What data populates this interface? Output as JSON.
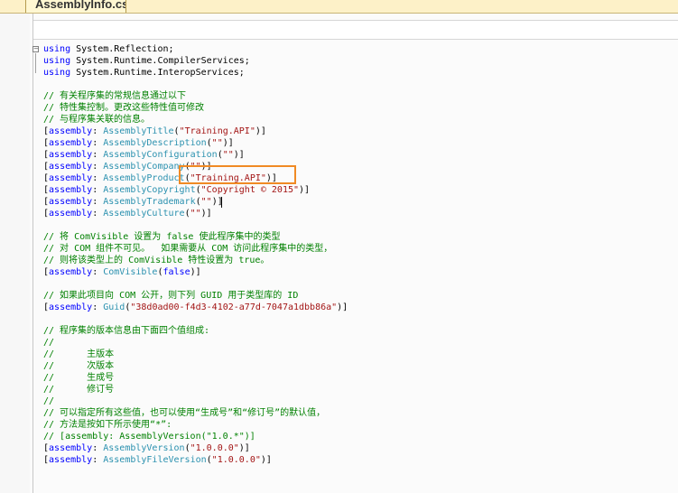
{
  "tab": {
    "title": "AssemblyInfo.cs"
  },
  "lines": [
    [
      {
        "c": "keyword",
        "t": "using"
      },
      {
        "c": "",
        "t": " System.Reflection;"
      }
    ],
    [
      {
        "c": "keyword",
        "t": "using"
      },
      {
        "c": "",
        "t": " System.Runtime.CompilerServices;"
      }
    ],
    [
      {
        "c": "keyword",
        "t": "using"
      },
      {
        "c": "",
        "t": " System.Runtime.InteropServices;"
      }
    ],
    [],
    [
      {
        "c": "comment",
        "t": "// 有关程序集的常规信息通过以下"
      }
    ],
    [
      {
        "c": "comment",
        "t": "// 特性集控制。更改这些特性值可修改"
      }
    ],
    [
      {
        "c": "comment",
        "t": "// 与程序集关联的信息。"
      }
    ],
    [
      {
        "c": "",
        "t": "["
      },
      {
        "c": "keyword",
        "t": "assembly"
      },
      {
        "c": "",
        "t": ": "
      },
      {
        "c": "type",
        "t": "AssemblyTitle"
      },
      {
        "c": "",
        "t": "("
      },
      {
        "c": "string",
        "t": "\"Training.API\""
      },
      {
        "c": "",
        "t": ")]"
      }
    ],
    [
      {
        "c": "",
        "t": "["
      },
      {
        "c": "keyword",
        "t": "assembly"
      },
      {
        "c": "",
        "t": ": "
      },
      {
        "c": "type",
        "t": "AssemblyDescription"
      },
      {
        "c": "",
        "t": "("
      },
      {
        "c": "string",
        "t": "\"\""
      },
      {
        "c": "",
        "t": ")]"
      }
    ],
    [
      {
        "c": "",
        "t": "["
      },
      {
        "c": "keyword",
        "t": "assembly"
      },
      {
        "c": "",
        "t": ": "
      },
      {
        "c": "type",
        "t": "AssemblyConfiguration"
      },
      {
        "c": "",
        "t": "("
      },
      {
        "c": "string",
        "t": "\"\""
      },
      {
        "c": "",
        "t": ")]"
      }
    ],
    [
      {
        "c": "",
        "t": "["
      },
      {
        "c": "keyword",
        "t": "assembly"
      },
      {
        "c": "",
        "t": ": "
      },
      {
        "c": "type",
        "t": "AssemblyCompany"
      },
      {
        "c": "",
        "t": "("
      },
      {
        "c": "string",
        "t": "\"\""
      },
      {
        "c": "",
        "t": ")]"
      }
    ],
    [
      {
        "c": "",
        "t": "["
      },
      {
        "c": "keyword",
        "t": "assembly"
      },
      {
        "c": "",
        "t": ": "
      },
      {
        "c": "type",
        "t": "AssemblyProduct"
      },
      {
        "c": "",
        "t": "("
      },
      {
        "c": "string",
        "t": "\"Training.API\""
      },
      {
        "c": "",
        "t": ")]"
      }
    ],
    [
      {
        "c": "",
        "t": "["
      },
      {
        "c": "keyword",
        "t": "assembly"
      },
      {
        "c": "",
        "t": ": "
      },
      {
        "c": "type",
        "t": "AssemblyCopyright"
      },
      {
        "c": "",
        "t": "("
      },
      {
        "c": "string",
        "t": "\"Copyright © 2015\""
      },
      {
        "c": "",
        "t": ")]"
      }
    ],
    [
      {
        "c": "",
        "t": "["
      },
      {
        "c": "keyword",
        "t": "assembly"
      },
      {
        "c": "",
        "t": ": "
      },
      {
        "c": "type",
        "t": "AssemblyTrademark"
      },
      {
        "c": "",
        "t": "("
      },
      {
        "c": "string",
        "t": "\"\""
      },
      {
        "c": "",
        "t": ")]"
      }
    ],
    [
      {
        "c": "",
        "t": "["
      },
      {
        "c": "keyword",
        "t": "assembly"
      },
      {
        "c": "",
        "t": ": "
      },
      {
        "c": "type",
        "t": "AssemblyCulture"
      },
      {
        "c": "",
        "t": "("
      },
      {
        "c": "string",
        "t": "\"\""
      },
      {
        "c": "",
        "t": ")]"
      }
    ],
    [],
    [
      {
        "c": "comment",
        "t": "// 将 ComVisible 设置为 false 使此程序集中的类型"
      }
    ],
    [
      {
        "c": "comment",
        "t": "// 对 COM 组件不可见。  如果需要从 COM 访问此程序集中的类型，"
      }
    ],
    [
      {
        "c": "comment",
        "t": "// 则将该类型上的 ComVisible 特性设置为 true。"
      }
    ],
    [
      {
        "c": "",
        "t": "["
      },
      {
        "c": "keyword",
        "t": "assembly"
      },
      {
        "c": "",
        "t": ": "
      },
      {
        "c": "type",
        "t": "ComVisible"
      },
      {
        "c": "",
        "t": "("
      },
      {
        "c": "keyword",
        "t": "false"
      },
      {
        "c": "",
        "t": ")]"
      }
    ],
    [],
    [
      {
        "c": "comment",
        "t": "// 如果此项目向 COM 公开，则下列 GUID 用于类型库的 ID"
      }
    ],
    [
      {
        "c": "",
        "t": "["
      },
      {
        "c": "keyword",
        "t": "assembly"
      },
      {
        "c": "",
        "t": ": "
      },
      {
        "c": "type",
        "t": "Guid"
      },
      {
        "c": "",
        "t": "("
      },
      {
        "c": "string",
        "t": "\"38d0ad00-f4d3-4102-a77d-7047a1dbb86a\""
      },
      {
        "c": "",
        "t": ")]"
      }
    ],
    [],
    [
      {
        "c": "comment",
        "t": "// 程序集的版本信息由下面四个值组成:"
      }
    ],
    [
      {
        "c": "comment",
        "t": "//"
      }
    ],
    [
      {
        "c": "comment",
        "t": "//      主版本"
      }
    ],
    [
      {
        "c": "comment",
        "t": "//      次版本"
      }
    ],
    [
      {
        "c": "comment",
        "t": "//      生成号"
      }
    ],
    [
      {
        "c": "comment",
        "t": "//      修订号"
      }
    ],
    [
      {
        "c": "comment",
        "t": "//"
      }
    ],
    [
      {
        "c": "comment",
        "t": "// 可以指定所有这些值，也可以使用“生成号”和“修订号”的默认值，"
      }
    ],
    [
      {
        "c": "comment",
        "t": "// 方法是按如下所示使用“*”:"
      }
    ],
    [
      {
        "c": "comment",
        "t": "// [assembly: AssemblyVersion(\"1.0.*\")]"
      }
    ],
    [
      {
        "c": "",
        "t": "["
      },
      {
        "c": "keyword",
        "t": "assembly"
      },
      {
        "c": "",
        "t": ": "
      },
      {
        "c": "type",
        "t": "AssemblyVersion"
      },
      {
        "c": "",
        "t": "("
      },
      {
        "c": "string",
        "t": "\"1.0.0.0\""
      },
      {
        "c": "",
        "t": ")]"
      }
    ],
    [
      {
        "c": "",
        "t": "["
      },
      {
        "c": "keyword",
        "t": "assembly"
      },
      {
        "c": "",
        "t": ": "
      },
      {
        "c": "type",
        "t": "AssemblyFileVersion"
      },
      {
        "c": "",
        "t": "("
      },
      {
        "c": "string",
        "t": "\"1.0.0.0\""
      },
      {
        "c": "",
        "t": ")]"
      }
    ]
  ],
  "colors": {
    "keyword": "#0000ff",
    "comment": "#008000",
    "type": "#2b91af",
    "string": "#a31515",
    "highlight": "#f08a24"
  }
}
